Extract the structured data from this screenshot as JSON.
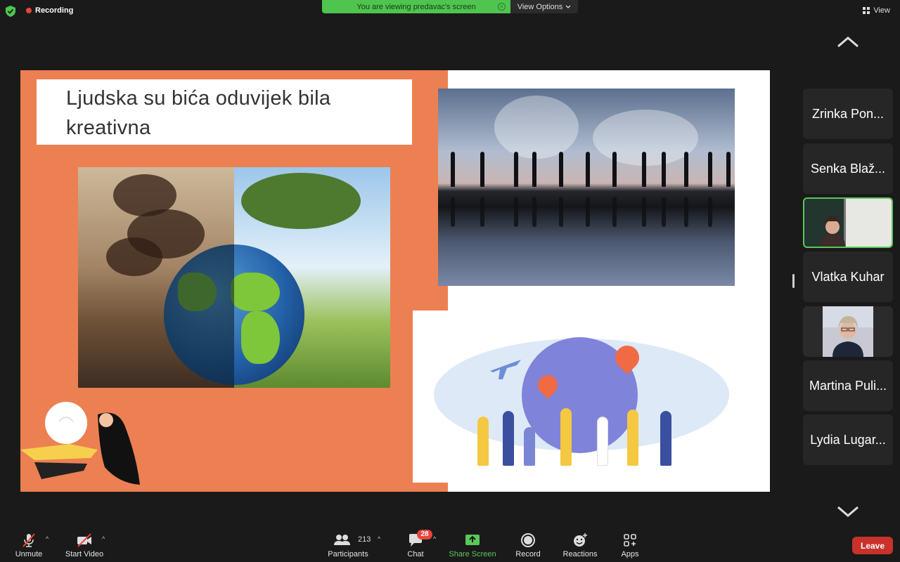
{
  "top_bar": {
    "recording_label": "Recording",
    "viewing_banner": "You are viewing predavac's screen",
    "view_options_label": "View Options",
    "view_label": "View"
  },
  "slide": {
    "title_line1": "Ljudska su bića oduvijek bila",
    "title_line2": "kreativna",
    "accent_color": "#ec8052"
  },
  "gallery": {
    "participants": [
      {
        "name": "Zrinka Pon...",
        "type": "name"
      },
      {
        "name": "Senka Blaž...",
        "type": "name"
      },
      {
        "name": "",
        "type": "video",
        "active": true
      },
      {
        "name": "Vlatka Kuhar",
        "type": "name"
      },
      {
        "name": "",
        "type": "video"
      },
      {
        "name": "Martina Puli...",
        "type": "name"
      },
      {
        "name": "Lydia Lugar...",
        "type": "name"
      }
    ]
  },
  "toolbar": {
    "unmute_label": "Unmute",
    "start_video_label": "Start Video",
    "participants_label": "Participants",
    "participants_count": "213",
    "chat_label": "Chat",
    "chat_badge": "28",
    "share_screen_label": "Share Screen",
    "record_label": "Record",
    "reactions_label": "Reactions",
    "apps_label": "Apps",
    "leave_label": "Leave",
    "share_color": "#5ac85a",
    "leave_color": "#c8322a"
  }
}
